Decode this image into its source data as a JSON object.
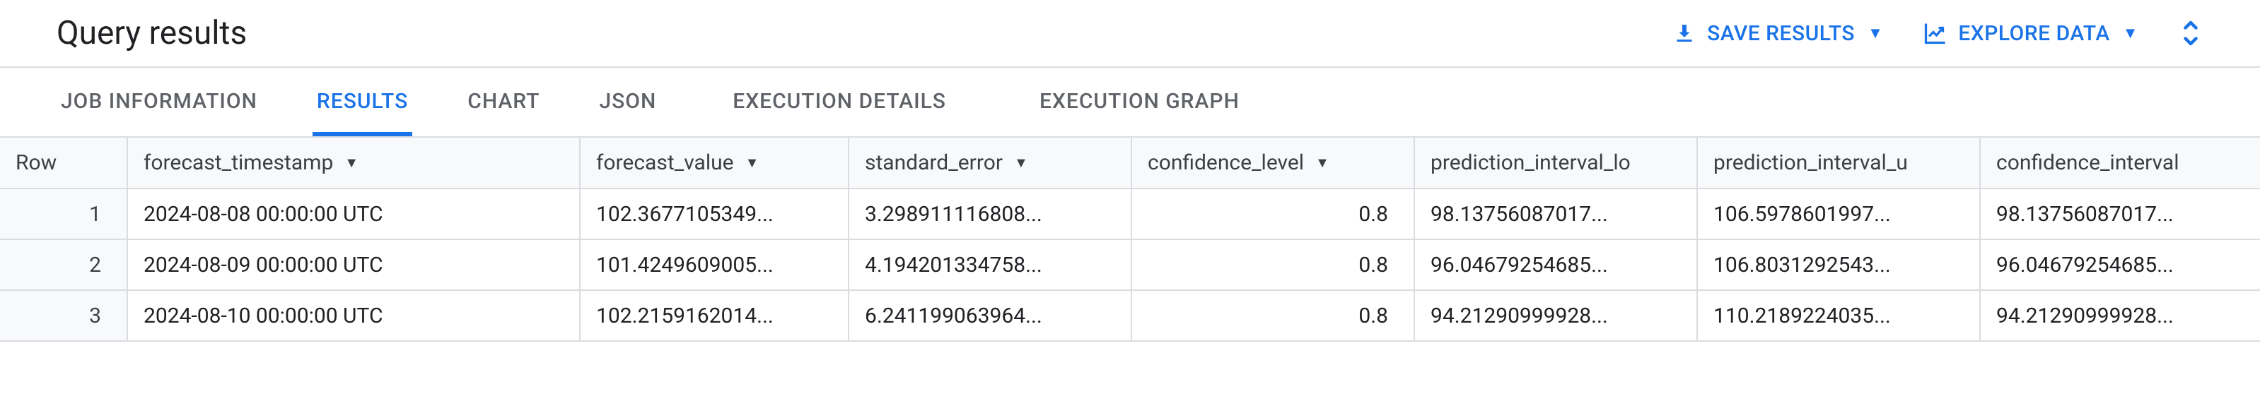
{
  "header": {
    "title": "Query results",
    "save_results_label": "SAVE RESULTS",
    "explore_data_label": "EXPLORE DATA"
  },
  "tabs": {
    "job_information": "JOB INFORMATION",
    "results": "RESULTS",
    "chart": "CHART",
    "json": "JSON",
    "execution_details": "EXECUTION DETAILS",
    "execution_graph": "EXECUTION GRAPH",
    "active": "results"
  },
  "table": {
    "columns": {
      "row": "Row",
      "forecast_timestamp": "forecast_timestamp",
      "forecast_value": "forecast_value",
      "standard_error": "standard_error",
      "confidence_level": "confidence_level",
      "prediction_interval_lower": "prediction_interval_lo",
      "prediction_interval_upper": "prediction_interval_u",
      "confidence_interval": "confidence_interval"
    },
    "rows": [
      {
        "row": "1",
        "forecast_timestamp": "2024-08-08 00:00:00 UTC",
        "forecast_value": "102.3677105349...",
        "standard_error": "3.298911116808...",
        "confidence_level": "0.8",
        "prediction_interval_lower": "98.13756087017...",
        "prediction_interval_upper": "106.5978601997...",
        "confidence_interval": "98.13756087017..."
      },
      {
        "row": "2",
        "forecast_timestamp": "2024-08-09 00:00:00 UTC",
        "forecast_value": "101.4249609005...",
        "standard_error": "4.194201334758...",
        "confidence_level": "0.8",
        "prediction_interval_lower": "96.04679254685...",
        "prediction_interval_upper": "106.8031292543...",
        "confidence_interval": "96.04679254685..."
      },
      {
        "row": "3",
        "forecast_timestamp": "2024-08-10 00:00:00 UTC",
        "forecast_value": "102.2159162014...",
        "standard_error": "6.241199063964...",
        "confidence_level": "0.8",
        "prediction_interval_lower": "94.21290999928...",
        "prediction_interval_upper": "110.2189224035...",
        "confidence_interval": "94.21290999928..."
      }
    ]
  }
}
